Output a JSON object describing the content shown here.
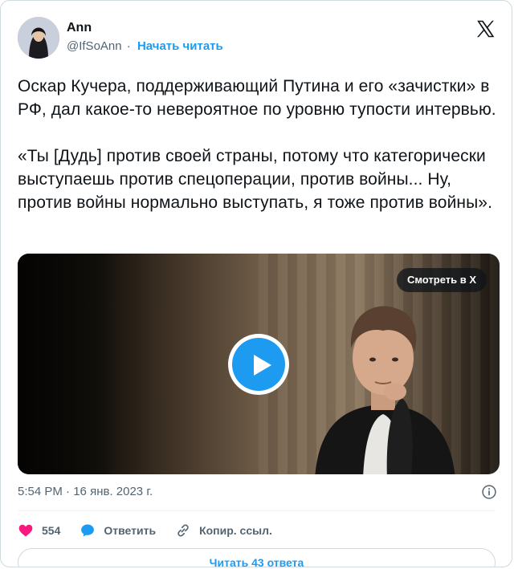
{
  "author": {
    "name": "Ann",
    "handle": "@IfSoAnn",
    "separator": "·",
    "follow_label": "Начать читать"
  },
  "tweet": {
    "paragraphs": [
      "Оскар Кучера, поддерживающий Путина и его «зачистки» в РФ, дал какое-то невероятное по уровню тупости интервью.",
      "«Ты [Дудь] против своей страны, потому что категорически выступаешь против спецоперации, против войны... Ну, против войны нормально выступать, я тоже против войны»."
    ]
  },
  "media": {
    "watch_label": "Смотреть в X"
  },
  "meta": {
    "time": "5:54 PM",
    "separator": "·",
    "date": "16 янв. 2023 г."
  },
  "actions": {
    "like_count": "554",
    "reply_label": "Ответить",
    "copy_label": "Копир. ссыл."
  },
  "footer": {
    "read_replies_label": "Читать 43 ответа"
  },
  "colors": {
    "accent": "#1d9bf0",
    "like": "#f91880",
    "muted": "#536471"
  }
}
